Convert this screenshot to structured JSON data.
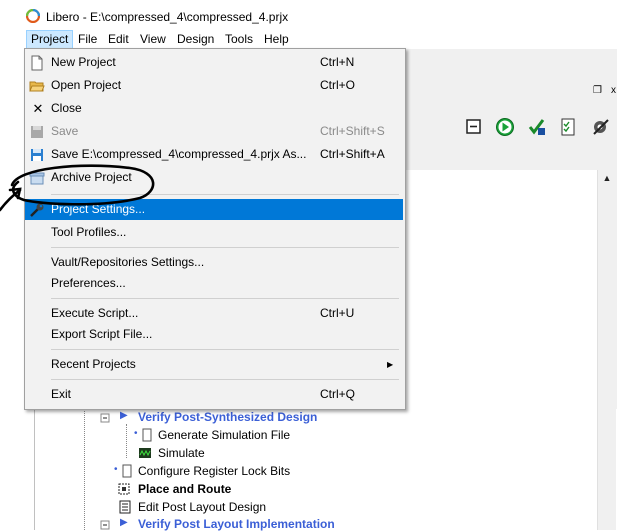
{
  "window": {
    "title": "Libero - E:\\compressed_4\\compressed_4.prjx",
    "logo_icon": "libero-logo-icon"
  },
  "menubar": {
    "items": [
      {
        "label": "Project",
        "active": true
      },
      {
        "label": "File"
      },
      {
        "label": "Edit"
      },
      {
        "label": "View"
      },
      {
        "label": "Design"
      },
      {
        "label": "Tools"
      },
      {
        "label": "Help"
      }
    ]
  },
  "project_menu": {
    "items": [
      {
        "label": "New Project",
        "shortcut": "Ctrl+N",
        "icon": "new-file-icon"
      },
      {
        "label": "Open Project",
        "shortcut": "Ctrl+O",
        "icon": "open-folder-icon"
      },
      {
        "label": "Close",
        "shortcut": "",
        "icon": "close-x-icon"
      },
      {
        "label": "Save",
        "shortcut": "Ctrl+Shift+S",
        "icon": "save-icon",
        "disabled": true
      },
      {
        "label": "Save E:\\compressed_4\\compressed_4.prjx As...",
        "shortcut": "Ctrl+Shift+A",
        "icon": "save-as-icon"
      },
      {
        "label": "Archive Project",
        "shortcut": "",
        "icon": "archive-icon"
      },
      {
        "label": "Project Settings...",
        "shortcut": "",
        "icon": "wrench-icon",
        "selected": true
      },
      {
        "label": "Tool Profiles...",
        "shortcut": ""
      },
      {
        "label": "Vault/Repositories Settings...",
        "shortcut": ""
      },
      {
        "label": "Preferences...",
        "shortcut": ""
      },
      {
        "label": "Execute Script...",
        "shortcut": "Ctrl+U"
      },
      {
        "label": "Export Script File...",
        "shortcut": ""
      },
      {
        "label": "Recent Projects",
        "shortcut": "",
        "submenu": true
      },
      {
        "label": "Exit",
        "shortcut": "Ctrl+Q"
      }
    ]
  },
  "design_flow": {
    "rows": [
      {
        "label": "Verify Post-Synthesized Design",
        "style": "blue"
      },
      {
        "label": "Generate Simulation File",
        "style": "normal"
      },
      {
        "label": "Simulate",
        "style": "normal"
      },
      {
        "label": "Configure Register Lock Bits",
        "style": "normal"
      },
      {
        "label": "Place and Route",
        "style": "bold"
      },
      {
        "label": "Edit Post Layout Design",
        "style": "normal"
      },
      {
        "label": "Verify Post Layout Implementation",
        "style": "blue"
      }
    ]
  },
  "colors": {
    "selection": "#0078d7",
    "menu_bg": "#f2f2f2",
    "flow_blue": "#3b5fd6"
  }
}
